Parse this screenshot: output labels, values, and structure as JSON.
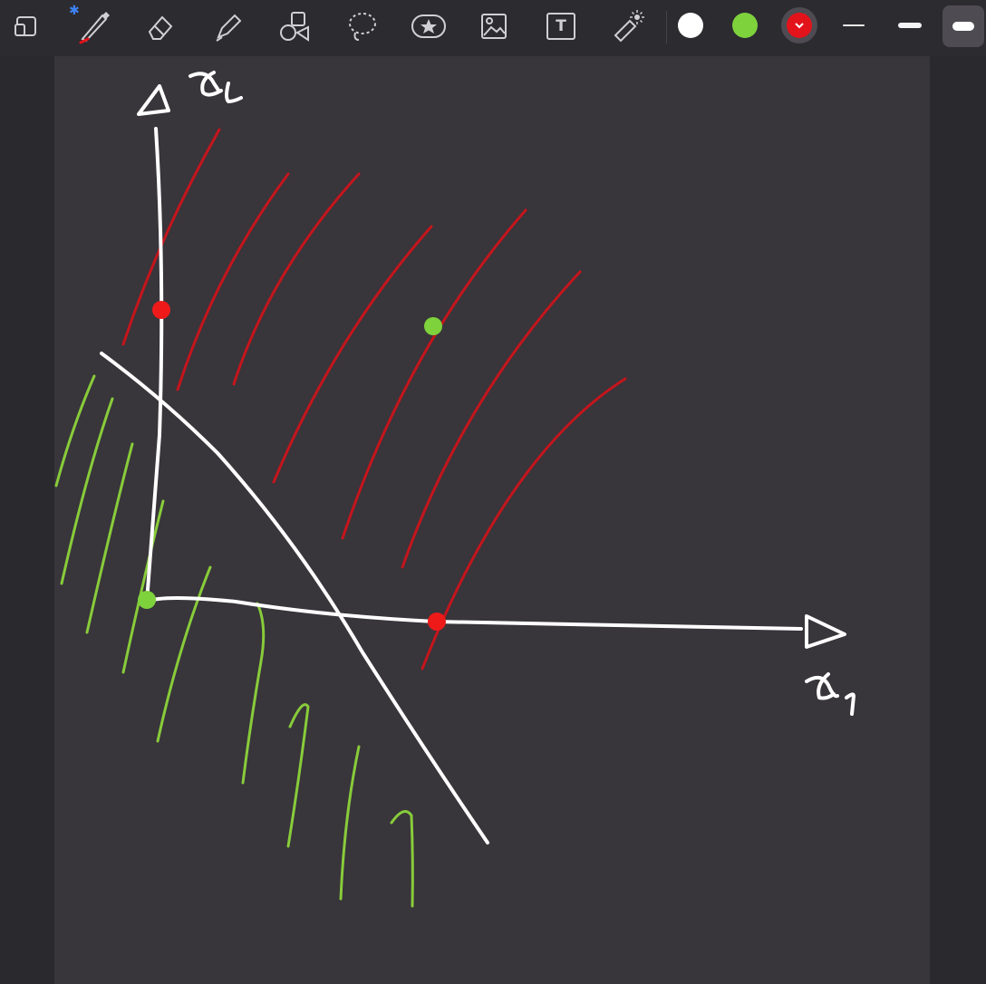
{
  "toolbar": {
    "tools": [
      {
        "name": "page-layout-icon",
        "active": false
      },
      {
        "name": "pen-icon",
        "active": true
      },
      {
        "name": "eraser-icon",
        "active": false
      },
      {
        "name": "highlighter-icon",
        "active": false
      },
      {
        "name": "shapes-icon",
        "active": false
      },
      {
        "name": "lasso-icon",
        "active": false
      },
      {
        "name": "sticker-icon",
        "active": false
      },
      {
        "name": "image-icon",
        "active": false
      },
      {
        "name": "text-icon",
        "active": false
      },
      {
        "name": "laser-pointer-icon",
        "active": false
      }
    ],
    "text_tool_glyph": "T",
    "bluetooth_glyph": "✱",
    "colors": [
      {
        "name": "white",
        "hex": "#ffffff",
        "selected": false
      },
      {
        "name": "green",
        "hex": "#7ed23c",
        "selected": false
      },
      {
        "name": "red",
        "hex": "#e3131b",
        "selected": true
      }
    ],
    "stroke_widths": [
      "thin",
      "medium",
      "thick"
    ],
    "selected_stroke_width": "thick"
  },
  "canvas": {
    "background": "#38353b",
    "ink_colors": {
      "white": "#ffffff",
      "red": "#c4151c",
      "green": "#88cc3a",
      "green_dot": "#7ed23c",
      "red_dot": "#ee1a1a"
    },
    "handwriting": {
      "x2_label": "x2",
      "x1_label": "x1"
    }
  }
}
